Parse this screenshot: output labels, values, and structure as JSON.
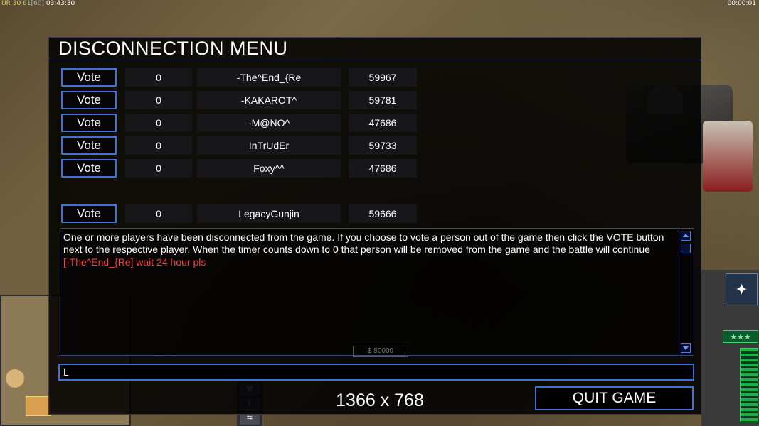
{
  "hud": {
    "left_prefix": "UR",
    "left_a": "30",
    "left_b": "61",
    "left_c": "[60]",
    "left_time": "03:43:30",
    "right_time": "00:00:01"
  },
  "dialog": {
    "title": "DISCONNECTION MENU",
    "vote_label": "Vote",
    "players": [
      {
        "votes": "0",
        "name": "-The^End_{Re",
        "id": "59967"
      },
      {
        "votes": "0",
        "name": "-KAKAROT^",
        "id": "59781"
      },
      {
        "votes": "0",
        "name": "-M@NO^",
        "id": "47686"
      },
      {
        "votes": "0",
        "name": "InTrUdEr",
        "id": "59733"
      },
      {
        "votes": "0",
        "name": "Foxy^^",
        "id": "47686"
      }
    ],
    "local_player": {
      "votes": "0",
      "name": "LegacyGunjin",
      "id": "59666"
    },
    "message": "One or more players have been disconnected from the game. If you choose to vote a person out of the game then click the VOTE button next to the respective player. When the timer counts down to 0 that person will be removed from the game and the battle will continue",
    "chat_line": "[-The^End_{Re] wait 24 hour pls",
    "chat_input_value": "L",
    "quit_label": "QUIT GAME"
  },
  "overlay_resolution": "1366 x 768",
  "sidebar": {
    "rank_stars": "★★★",
    "money": "$ 50000"
  },
  "colors": {
    "accent_border": "#3f72d6",
    "chat_red": "#ff3b3b"
  },
  "icons": {
    "scroll_up": "triangle-up",
    "scroll_down": "triangle-down",
    "satellite": "satellite-icon"
  }
}
